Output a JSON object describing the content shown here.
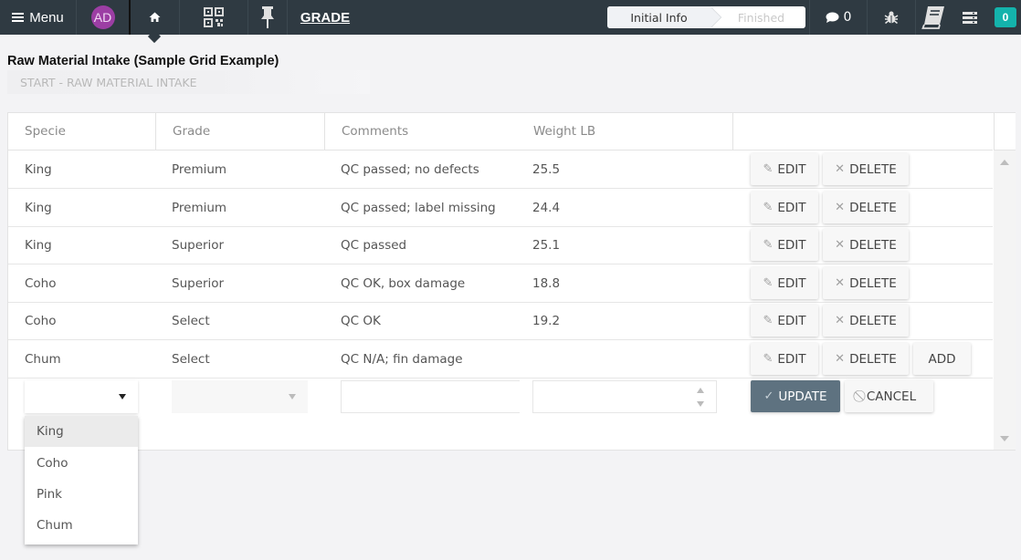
{
  "topbar": {
    "menu_label": "Menu",
    "avatar_initials": "AD",
    "grade_link": "GRADE",
    "steps": [
      "Initial Info",
      "Finished"
    ],
    "comments_count": "0",
    "notification_count": "0",
    "icons": [
      "hamburger-icon",
      "home-icon",
      "qr-code-icon",
      "pin-icon",
      "chat-icon",
      "bug-icon",
      "book-icon",
      "list-icon"
    ]
  },
  "page": {
    "title": "Raw Material Intake (Sample Grid Example)",
    "section_label": "START - RAW MATERIAL INTAKE"
  },
  "grid": {
    "columns": [
      "Specie",
      "Grade",
      "Comments",
      "Weight LB",
      ""
    ],
    "rows": [
      {
        "specie": "King",
        "grade": "Premium",
        "comments": "QC passed; no defects",
        "weight": "25.5"
      },
      {
        "specie": "King",
        "grade": "Premium",
        "comments": "QC passed; label missing",
        "weight": "24.4"
      },
      {
        "specie": "King",
        "grade": "Superior",
        "comments": "QC passed",
        "weight": "25.1"
      },
      {
        "specie": "Coho",
        "grade": "Superior",
        "comments": "QC OK, box damage",
        "weight": "18.8"
      },
      {
        "specie": "Coho",
        "grade": "Select",
        "comments": "QC OK",
        "weight": "19.2"
      },
      {
        "specie": "Chum",
        "grade": "Select",
        "comments": "QC N/A; fin damage",
        "weight": ""
      }
    ],
    "edit_label": "EDIT",
    "delete_label": "DELETE",
    "add_label": "ADD",
    "update_label": "UPDATE",
    "cancel_label": "CANCEL",
    "edit_row": {
      "specie": "",
      "grade": "",
      "comments": "",
      "weight": ""
    },
    "specie_options": [
      "King",
      "Coho",
      "Pink",
      "Chum"
    ],
    "highlighted_option": "King"
  },
  "colors": {
    "topbar": "#2f3a42",
    "avatar": "#9c3ea4",
    "badge": "#14b3ac",
    "update_button": "#5e7280"
  }
}
